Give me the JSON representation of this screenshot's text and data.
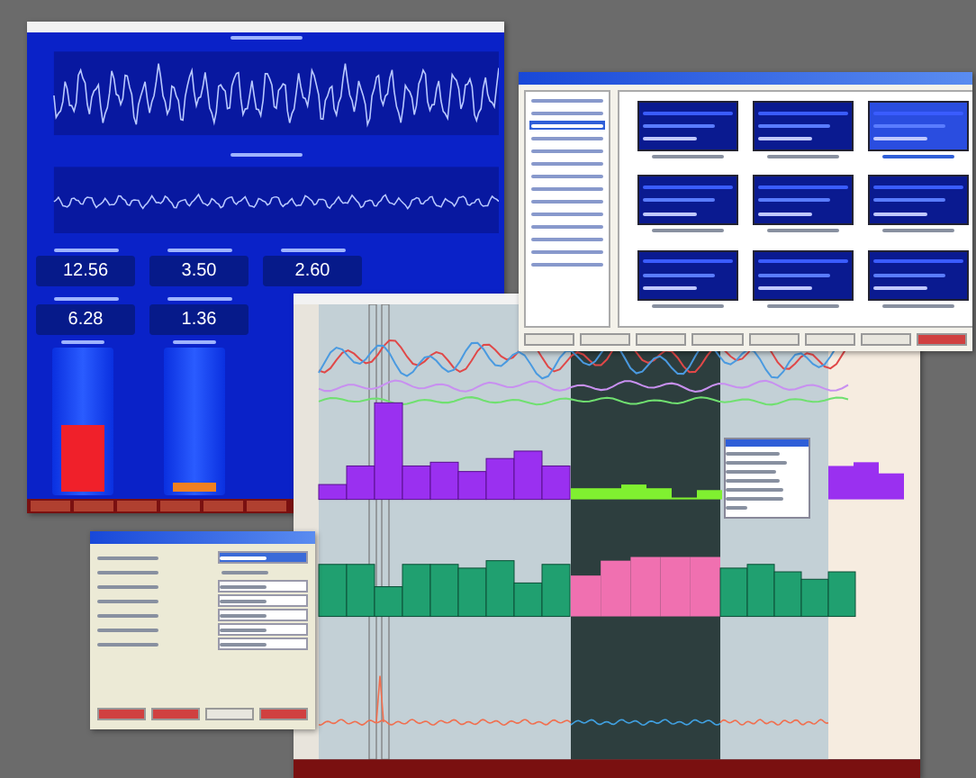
{
  "monitor": {
    "tiles": [
      {
        "value": "12.56"
      },
      {
        "value": "3.50"
      },
      {
        "value": "2.60"
      },
      {
        "value": "6.28"
      },
      {
        "value": "1.36"
      }
    ],
    "gauges": [
      {
        "level": 0.45,
        "color": "#f0202a"
      },
      {
        "level": 0.06,
        "color": "#f08020"
      }
    ]
  },
  "chooser": {
    "categories": [
      {
        "selected": false
      },
      {
        "selected": false
      },
      {
        "selected": true
      },
      {
        "selected": false
      },
      {
        "selected": false
      },
      {
        "selected": false
      },
      {
        "selected": false
      },
      {
        "selected": false
      },
      {
        "selected": false
      },
      {
        "selected": false
      },
      {
        "selected": false
      },
      {
        "selected": false
      },
      {
        "selected": false
      },
      {
        "selected": false
      }
    ],
    "thumbnails": [
      {
        "selected": false
      },
      {
        "selected": false
      },
      {
        "selected": true
      },
      {
        "selected": false
      },
      {
        "selected": false
      },
      {
        "selected": false
      },
      {
        "selected": false
      },
      {
        "selected": false
      },
      {
        "selected": false
      }
    ]
  },
  "dialog": {
    "rows": [
      {
        "kind": "field"
      },
      {
        "kind": "text"
      },
      {
        "kind": "select"
      },
      {
        "kind": "select"
      },
      {
        "kind": "select"
      },
      {
        "kind": "select"
      },
      {
        "kind": "select"
      }
    ]
  }
}
